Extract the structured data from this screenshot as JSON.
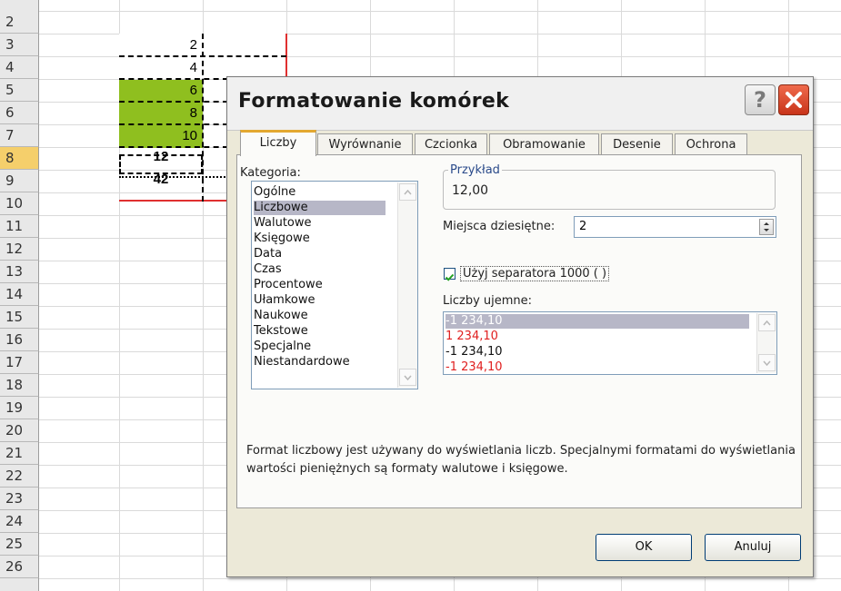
{
  "sheet": {
    "row_numbers": [
      "2",
      "3",
      "4",
      "5",
      "6",
      "7",
      "8",
      "9",
      "10",
      "11",
      "12",
      "13",
      "14",
      "15",
      "16",
      "17",
      "18",
      "19",
      "20",
      "21",
      "22",
      "23",
      "24",
      "25",
      "26"
    ],
    "cells": [
      "2",
      "4",
      "6",
      "8",
      "10",
      "12",
      "42"
    ],
    "accent_green": "#8fbf1f",
    "accent_red": "#e03030"
  },
  "dialog": {
    "title": "Formatowanie komórek",
    "help_icon": "question-icon",
    "close_icon": "close-x-icon",
    "tabs": [
      "Liczby",
      "Wyrównanie",
      "Czcionka",
      "Obramowanie",
      "Desenie",
      "Ochrona"
    ],
    "active_tab": "Liczby",
    "category_label": "Kategoria:",
    "categories": [
      "Ogólne",
      "Liczbowe",
      "Walutowe",
      "Księgowe",
      "Data",
      "Czas",
      "Procentowe",
      "Ułamkowe",
      "Naukowe",
      "Tekstowe",
      "Specjalne",
      "Niestandardowe"
    ],
    "selected_category": "Liczbowe",
    "sample_label": "Przykład",
    "sample_value": "12,00",
    "decimal_label": "Miejsca dziesiętne:",
    "decimal_value": "2",
    "separator_label": "Użyj separatora 1000 ( )",
    "separator_checked": true,
    "negative_label": "Liczby ujemne:",
    "negative_numbers": [
      {
        "text": "-1 234,10",
        "color": "#ffffff",
        "selected": true
      },
      {
        "text": "1 234,10",
        "color": "#e02020",
        "selected": false
      },
      {
        "text": "-1 234,10",
        "color": "#111111",
        "selected": false
      },
      {
        "text": "-1 234,10",
        "color": "#e02020",
        "selected": false
      }
    ],
    "description": "Format liczbowy jest używany do wyświetlania liczb. Specjalnymi formatami do wyświetlania wartości pieniężnych są formaty walutowe i księgowe.",
    "ok_label": "OK",
    "cancel_label": "Anuluj"
  }
}
